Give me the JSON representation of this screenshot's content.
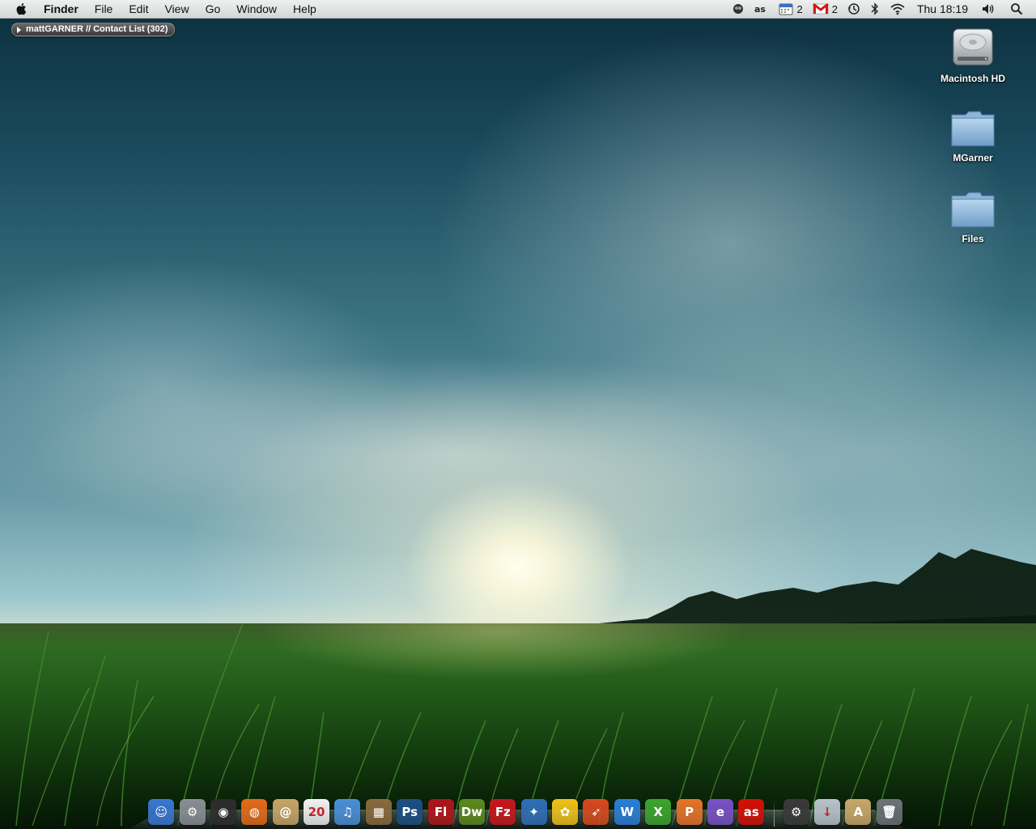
{
  "menubar": {
    "app_name": "Finder",
    "items": [
      {
        "label": "File"
      },
      {
        "label": "Edit"
      },
      {
        "label": "View"
      },
      {
        "label": "Go"
      },
      {
        "label": "Window"
      },
      {
        "label": "Help"
      }
    ],
    "status": {
      "calendar_count": "2",
      "gmail_count": "2",
      "clock": "Thu 18:19"
    }
  },
  "contact_pill": {
    "label": "mattGARNER // Contact List (302)"
  },
  "desktop_icons": [
    {
      "label": "Macintosh HD",
      "icon": "hard-drive-icon"
    },
    {
      "label": "MGarner",
      "icon": "folder-icon"
    },
    {
      "label": "Files",
      "icon": "folder-icon"
    }
  ],
  "dock": {
    "apps": [
      {
        "name": "finder-icon",
        "glyph": "☺",
        "color": "#3a78d4",
        "running": true
      },
      {
        "name": "system-preferences-icon",
        "glyph": "⚙",
        "color": "#8a8f96",
        "running": false
      },
      {
        "name": "dashboard-icon",
        "glyph": "◉",
        "color": "#2d2d2d",
        "running": false
      },
      {
        "name": "firefox-icon",
        "glyph": "◍",
        "color": "#e66a1a",
        "running": true
      },
      {
        "name": "address-book-icon",
        "glyph": "@",
        "color": "#c9a56a",
        "running": false
      },
      {
        "name": "ical-icon",
        "glyph": "20",
        "color": "#f3f3f3",
        "running": false
      },
      {
        "name": "itunes-icon",
        "glyph": "♫",
        "color": "#4a90d9",
        "running": true
      },
      {
        "name": "iphoto-icon",
        "glyph": "▦",
        "color": "#8b6a3e",
        "running": false
      },
      {
        "name": "photoshop-icon",
        "glyph": "Ps",
        "color": "#1d4f86",
        "running": false
      },
      {
        "name": "flash-icon",
        "glyph": "Fl",
        "color": "#b0161b",
        "running": false
      },
      {
        "name": "dreamweaver-icon",
        "glyph": "Dw",
        "color": "#5d8a1e",
        "running": false
      },
      {
        "name": "filezilla-icon",
        "glyph": "Fz",
        "color": "#c8161d",
        "running": false
      },
      {
        "name": "adium-icon",
        "glyph": "✦",
        "color": "#2f6fb8",
        "running": true
      },
      {
        "name": "cyberduck-icon",
        "glyph": "✿",
        "color": "#f1c21b",
        "running": false
      },
      {
        "name": "transmit-icon",
        "glyph": "➶",
        "color": "#d94a1e",
        "running": false
      },
      {
        "name": "word-icon",
        "glyph": "W",
        "color": "#2b7fd8",
        "running": false
      },
      {
        "name": "excel-icon",
        "glyph": "X",
        "color": "#3da52f",
        "running": false
      },
      {
        "name": "powerpoint-icon",
        "glyph": "P",
        "color": "#e8742a",
        "running": false
      },
      {
        "name": "entourage-icon",
        "glyph": "e",
        "color": "#7a52c7",
        "running": true
      },
      {
        "name": "lastfm-icon",
        "glyph": "as",
        "color": "#d51007",
        "running": false
      }
    ],
    "stacks": [
      {
        "name": "applications-stack-icon",
        "glyph": "⚙",
        "color": "#3a3a3a"
      },
      {
        "name": "downloads-stack-icon",
        "glyph": "↓",
        "color": "#b9c4cc"
      },
      {
        "name": "documents-stack-icon",
        "glyph": "A",
        "color": "#c9a86a"
      },
      {
        "name": "trash-icon",
        "glyph": "🗑",
        "color": "#6d7478"
      }
    ]
  }
}
